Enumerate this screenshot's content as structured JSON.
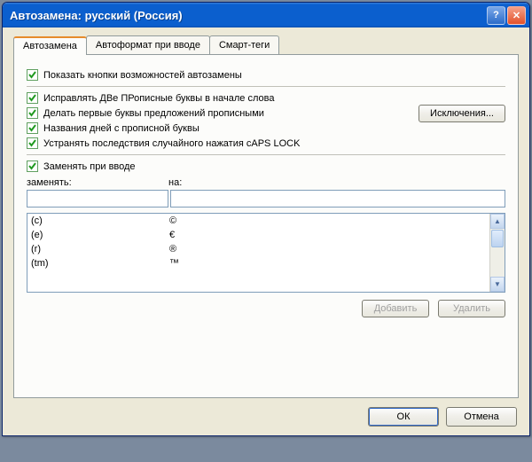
{
  "titlebar": {
    "title": "Автозамена: русский (Россия)"
  },
  "tabs": [
    {
      "label": "Автозамена",
      "active": true
    },
    {
      "label": "Автоформат при вводе",
      "active": false
    },
    {
      "label": "Смарт-теги",
      "active": false
    }
  ],
  "options": {
    "show_buttons": {
      "label": "Показать кнопки возможностей автозамены",
      "checked": true
    },
    "two_caps": {
      "label": "Исправлять ДВе ПРописные буквы в начале слова",
      "checked": true
    },
    "sentence_cap": {
      "label": "Делать первые буквы предложений прописными",
      "checked": true
    },
    "day_names": {
      "label": "Названия дней с прописной буквы",
      "checked": true
    },
    "caps_lock": {
      "label": "Устранять последствия случайного нажатия cAPS LOCK",
      "checked": true
    },
    "replace_on_type": {
      "label": "Заменять при вводе",
      "checked": true
    }
  },
  "exceptions_button": "Исключения...",
  "columns": {
    "replace": "заменять:",
    "with": "на:"
  },
  "inputs": {
    "replace": "",
    "with": ""
  },
  "replacements": [
    {
      "from": "(c)",
      "to": "©"
    },
    {
      "from": "(e)",
      "to": "€"
    },
    {
      "from": "(r)",
      "to": "®"
    },
    {
      "from": "(tm)",
      "to": "™"
    }
  ],
  "list_buttons": {
    "add": "Добавить",
    "delete": "Удалить"
  },
  "footer": {
    "ok": "ОК",
    "cancel": "Отмена"
  }
}
